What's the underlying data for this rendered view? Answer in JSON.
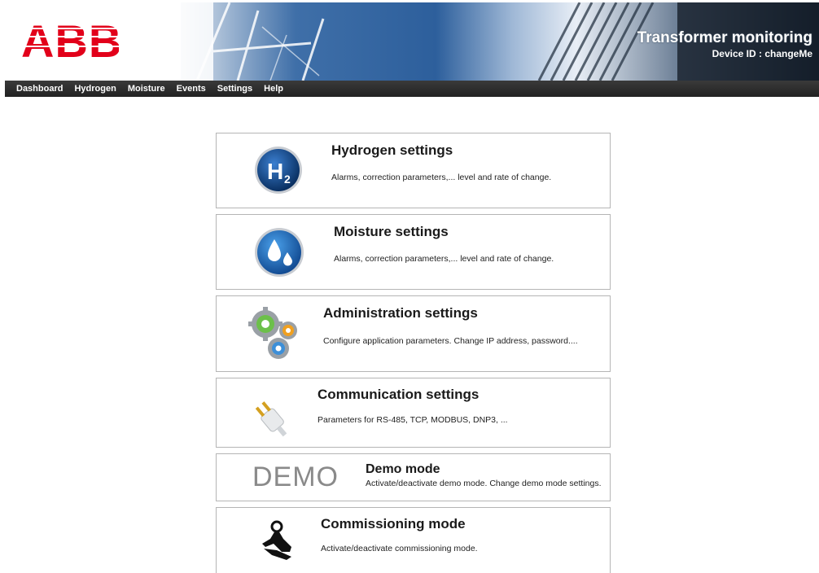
{
  "header": {
    "logo_text": "ABB",
    "app_title": "Transformer monitoring",
    "device_id": "Device ID : changeMe"
  },
  "nav": {
    "items": [
      {
        "label": "Dashboard"
      },
      {
        "label": "Hydrogen"
      },
      {
        "label": "Moisture"
      },
      {
        "label": "Events"
      },
      {
        "label": "Settings"
      },
      {
        "label": "Help"
      }
    ]
  },
  "cards": [
    {
      "title": "Hydrogen settings",
      "description": "Alarms, correction parameters,... level and rate of change.",
      "icon": "hydrogen-h2-icon"
    },
    {
      "title": "Moisture settings",
      "description": "Alarms, correction parameters,... level and rate of change.",
      "icon": "water-drops-icon"
    },
    {
      "title": "Administration settings",
      "description": "Configure application parameters. Change IP address, password....",
      "icon": "gears-icon"
    },
    {
      "title": "Communication settings",
      "description": "Parameters for RS-485, TCP, MODBUS, DNP3, ...",
      "icon": "plug-icon"
    },
    {
      "title": "Demo mode",
      "description": "Activate/deactivate demo mode. Change demo mode settings.",
      "icon_text": "DEMO"
    },
    {
      "title": "Commissioning mode",
      "description": "Activate/deactivate commissioning mode.",
      "icon": "hand-tool-icon"
    }
  ],
  "colors": {
    "abb_red": "#e2001a",
    "nav_bg": "#2b2b2b",
    "h2_blue": "#0b4a8c",
    "drop_blue": "#1565c0"
  }
}
